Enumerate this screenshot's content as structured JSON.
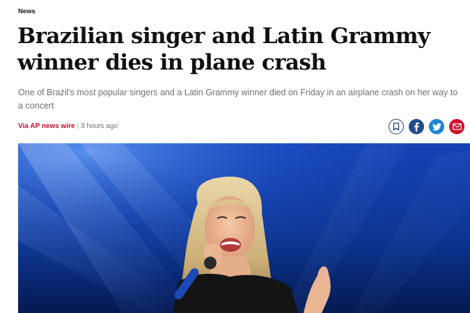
{
  "section": {
    "label": "News"
  },
  "headline": "Brazilian singer and Latin Grammy winner dies in plane crash",
  "standfirst": "One of Brazil's most popular singers and a Latin Grammy winner died on Friday in an airplane crash on her way to a concert",
  "byline": {
    "source": "Via AP news wire",
    "separator": "|",
    "time": "3 hours ago"
  },
  "share": {
    "icons": [
      "bookmark-icon",
      "facebook-icon",
      "twitter-icon",
      "email-icon"
    ]
  },
  "colors": {
    "source_red": "#c8102e",
    "facebook_blue": "#1f4d8c",
    "twitter_blue": "#1f84d8",
    "email_red": "#d0122b",
    "hero_blue": "#0a3fa6"
  }
}
